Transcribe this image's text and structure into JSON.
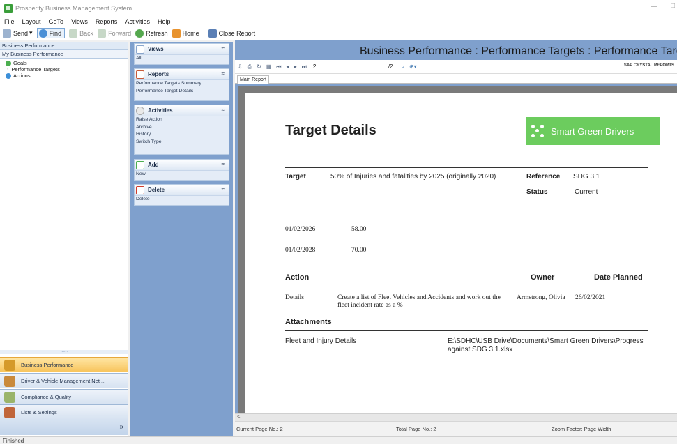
{
  "window": {
    "title": "Prosperity Business Management System",
    "min_glyph": "—",
    "max_glyph": "□"
  },
  "menu": [
    "File",
    "Layout",
    "GoTo",
    "Views",
    "Reports",
    "Activities",
    "Help"
  ],
  "toolbar": {
    "send": "Send",
    "find": "Find",
    "back": "Back",
    "forward": "Forward",
    "refresh": "Refresh",
    "home": "Home",
    "close_report": "Close Report"
  },
  "leftnav": {
    "header": "Business Performance",
    "subheader": "My Business Performance",
    "tree": [
      "Goals",
      "Performance Targets",
      "Actions"
    ],
    "splitter": "......",
    "buttons": [
      "Business Performance",
      "Driver & Vehicle Management Net ...",
      "Compliance & Quality",
      "Lists & Settings"
    ],
    "chevron": "»"
  },
  "taskpane": {
    "groups": [
      {
        "title": "Views",
        "items": [
          "All"
        ]
      },
      {
        "title": "Reports",
        "items": [
          "Performance Targets Summary",
          "Performance Target Details"
        ]
      },
      {
        "title": "Activities",
        "items": [
          "Raise Action",
          "Archive",
          "History",
          "Switch Type"
        ]
      },
      {
        "title": "Add",
        "items": [
          "New"
        ]
      },
      {
        "title": "Delete",
        "items": [
          "Delete"
        ]
      }
    ],
    "collapse_glyph": "≈"
  },
  "report": {
    "title": "Business Performance : Performance Targets : Performance Target Details",
    "page_input": "2",
    "page_total": "/2",
    "brand": "SAP CRYSTAL REPORTS",
    "tab": "Main Report",
    "scroll_left": "<",
    "status": {
      "current": "Current Page No.: 2",
      "total": "Total Page No.: 2",
      "zoom": "Zoom Factor: Page Width"
    }
  },
  "content": {
    "heading": "Target Details",
    "logo_text": "Smart Green Drivers",
    "target_label": "Target",
    "target_value": "50% of Injuries and fatalities by 2025 (originally 2020)",
    "reference_label": "Reference",
    "reference_value": "SDG 3.1",
    "status_label": "Status",
    "status_value": "Current",
    "measurements": [
      {
        "date": "01/02/2026",
        "value": "58.00"
      },
      {
        "date": "01/02/2028",
        "value": "70.00"
      }
    ],
    "action_header": "Action",
    "owner_header": "Owner",
    "date_planned_header": "Date Planned",
    "action_type": "Details",
    "action_desc_1": "Create a list of Fleet Vehicles and Accidents and work out the",
    "action_desc_2": "fleet incident rate as a %",
    "action_owner": "Armstrong, Olivia",
    "action_date": "26/02/2021",
    "attachments_header": "Attachments",
    "attachment_name": "Fleet and Injury Details",
    "attachment_path_1": "E:\\SDHC\\USB Drive\\Documents\\Smart Green Drivers\\Progress",
    "attachment_path_2": "against SDG 3.1.xlsx"
  },
  "app_status": "Finished",
  "colors": {
    "accent_orange": "#f7c35a",
    "pane_blue": "#7fa0cd",
    "logo_green": "#6ccc5e"
  }
}
